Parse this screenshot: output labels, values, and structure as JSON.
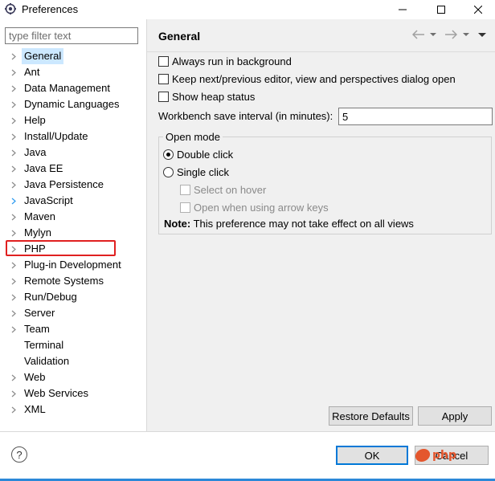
{
  "window": {
    "title": "Preferences"
  },
  "filter": {
    "placeholder": "type filter text"
  },
  "tree": {
    "items": [
      {
        "label": "General",
        "arrow": true,
        "selected": true
      },
      {
        "label": "Ant",
        "arrow": true
      },
      {
        "label": "Data Management",
        "arrow": true
      },
      {
        "label": "Dynamic Languages",
        "arrow": true
      },
      {
        "label": "Help",
        "arrow": true
      },
      {
        "label": "Install/Update",
        "arrow": true
      },
      {
        "label": "Java",
        "arrow": true
      },
      {
        "label": "Java EE",
        "arrow": true
      },
      {
        "label": "Java Persistence",
        "arrow": true
      },
      {
        "label": "JavaScript",
        "arrow": true,
        "arrow_highlight": true
      },
      {
        "label": "Maven",
        "arrow": true
      },
      {
        "label": "Mylyn",
        "arrow": true
      },
      {
        "label": "PHP",
        "arrow": true,
        "highlighted_box": true
      },
      {
        "label": "Plug-in Development",
        "arrow": true
      },
      {
        "label": "Remote Systems",
        "arrow": true
      },
      {
        "label": "Run/Debug",
        "arrow": true
      },
      {
        "label": "Server",
        "arrow": true
      },
      {
        "label": "Team",
        "arrow": true
      },
      {
        "label": "Terminal",
        "arrow": false
      },
      {
        "label": "Validation",
        "arrow": false
      },
      {
        "label": "Web",
        "arrow": true
      },
      {
        "label": "Web Services",
        "arrow": true
      },
      {
        "label": "XML",
        "arrow": true
      }
    ]
  },
  "page": {
    "title": "General",
    "options": {
      "always_run_background": "Always run in background",
      "keep_next_previous": "Keep next/previous editor, view and perspectives dialog open",
      "show_heap_status": "Show heap status"
    },
    "interval": {
      "label": "Workbench save interval (in minutes):",
      "value": "5"
    },
    "open_mode": {
      "title": "Open mode",
      "double_click": "Double click",
      "single_click": "Single click",
      "select_on_hover": "Select on hover",
      "open_arrow_keys": "Open when using arrow keys",
      "selected": "double_click"
    },
    "note": {
      "prefix": "Note:",
      "text": " This preference may not take effect on all views"
    },
    "buttons": {
      "restore_defaults": "Restore Defaults",
      "apply": "Apply"
    }
  },
  "footer": {
    "help": "?",
    "ok": "OK",
    "cancel": "Cancel",
    "watermark": "php"
  },
  "colors": {
    "selection": "#cce8ff",
    "highlight_border": "#e02020",
    "default_button_border": "#0078d7",
    "panel_bg": "#f0f0f0"
  },
  "icons": {
    "app": "eclipse-preferences-icon",
    "back": "back-arrow-icon",
    "forward": "forward-arrow-icon",
    "menu": "view-menu-icon"
  }
}
